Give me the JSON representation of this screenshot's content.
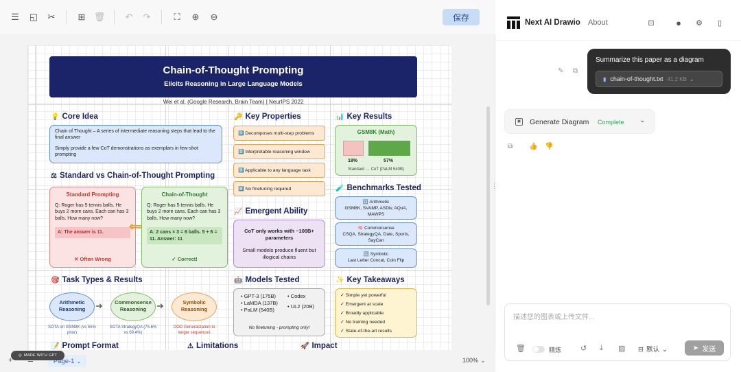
{
  "toolbar": {
    "save_label": "保存"
  },
  "diagram": {
    "title": "Chain-of-Thought Prompting",
    "subtitle": "Elicits Reasoning in Large Language Models",
    "authors": "Wei et al. (Google Research, Brain Team) | NeurIPS 2022",
    "core_idea": {
      "heading": "Core Idea",
      "definition": "Chain of Thought – A series of intermediate reasoning steps that lead to the final answer",
      "note": "Simply provide a few CoT demonstrations as exemplars in few-shot prompting"
    },
    "comparison": {
      "heading": "Standard vs Chain-of-Thought Prompting",
      "standard": {
        "title": "Standard Prompting",
        "question": "Q: Roger has 5 tennis balls. He buys 2 more cans. Each can has 3 balls. How many now?",
        "answer": "A: The answer is 11.",
        "verdict": "✕ Often Wrong"
      },
      "cot": {
        "title": "Chain-of-Thought",
        "question": "Q: Roger has 5 tennis balls. He buys 2 more cans. Each can has 3 balls. How many now?",
        "answer": "A: 2 cans × 3 = 6 balls. 5 + 6 = 11. Answer: 11",
        "verdict": "✓ Correct!"
      }
    },
    "key_properties": {
      "heading": "Key Properties",
      "items": [
        "1️⃣ Decomposes multi-step problems",
        "2️⃣ Interpretable reasoning window",
        "3️⃣ Applicable to any language task",
        "4️⃣ No finetuning required"
      ]
    },
    "emergent": {
      "heading": "Emergent Ability",
      "line1": "CoT only works with ~100B+ parameters",
      "line2": "Small models produce fluent but illogical chains"
    },
    "key_results": {
      "heading": "Key Results",
      "box_title": "GSM8K (Math)",
      "standard_value": "18%",
      "cot_value": "57%",
      "caption": "Standard → CoT (PaLM 540B)"
    },
    "benchmarks": {
      "heading": "Benchmarks Tested",
      "items": [
        {
          "title": "🔢 Arithmetic",
          "detail": "GSM8K, SVAMP, ASDiv, AQuA, MAWPS"
        },
        {
          "title": "🧠 Commonsense",
          "detail": "CSQA, StrategyQA, Date, Sports, SayCan"
        },
        {
          "title": "🔣 Symbolic",
          "detail": "Last Letter Concat, Coin Flip"
        }
      ]
    },
    "task_types": {
      "heading": "Task Types & Results",
      "nodes": [
        "Arithmetic Reasoning",
        "Commonsense Reasoning",
        "Symbolic Reasoning"
      ],
      "notes": [
        "SOTA on GSM8K (vs 55% prior)",
        "SOTA StrategyQA (75.6% vs 69.4%)",
        "OOD Generalization to longer sequences"
      ]
    },
    "models": {
      "heading": "Models Tested",
      "left": [
        "• GPT-3 (175B)",
        "• LaMDA (137B)",
        "• PaLM (540B)"
      ],
      "right": [
        "• Codex",
        "• UL2 (20B)"
      ],
      "footnote": "No finetuning - prompting only!"
    },
    "takeaways": {
      "heading": "Key Takeaways",
      "items": [
        "✓ Simple yet powerful",
        "✓ Emergent at scale",
        "✓ Broadly applicable",
        "✓ No training needed",
        "✓ State-of-the-art results"
      ]
    },
    "partial_headings": [
      "Prompt Format",
      "Limitations",
      "Impact"
    ]
  },
  "bottom_bar": {
    "badge": "MADE WITH GPT",
    "page_tab": "Page-1",
    "zoom": "100%"
  },
  "chat": {
    "app_title": "Next AI Drawio",
    "about": "About",
    "user_message": "Summarize this paper as a diagram",
    "file_name": "chain-of-thought.txt",
    "file_size": "41.2 KB",
    "tool_name": "Generate Diagram",
    "tool_status": "Complete",
    "composer_placeholder": "描述您的图表或上传文件...",
    "toggle_label": "精炼",
    "model_label": "默认",
    "send_label": "发送"
  }
}
